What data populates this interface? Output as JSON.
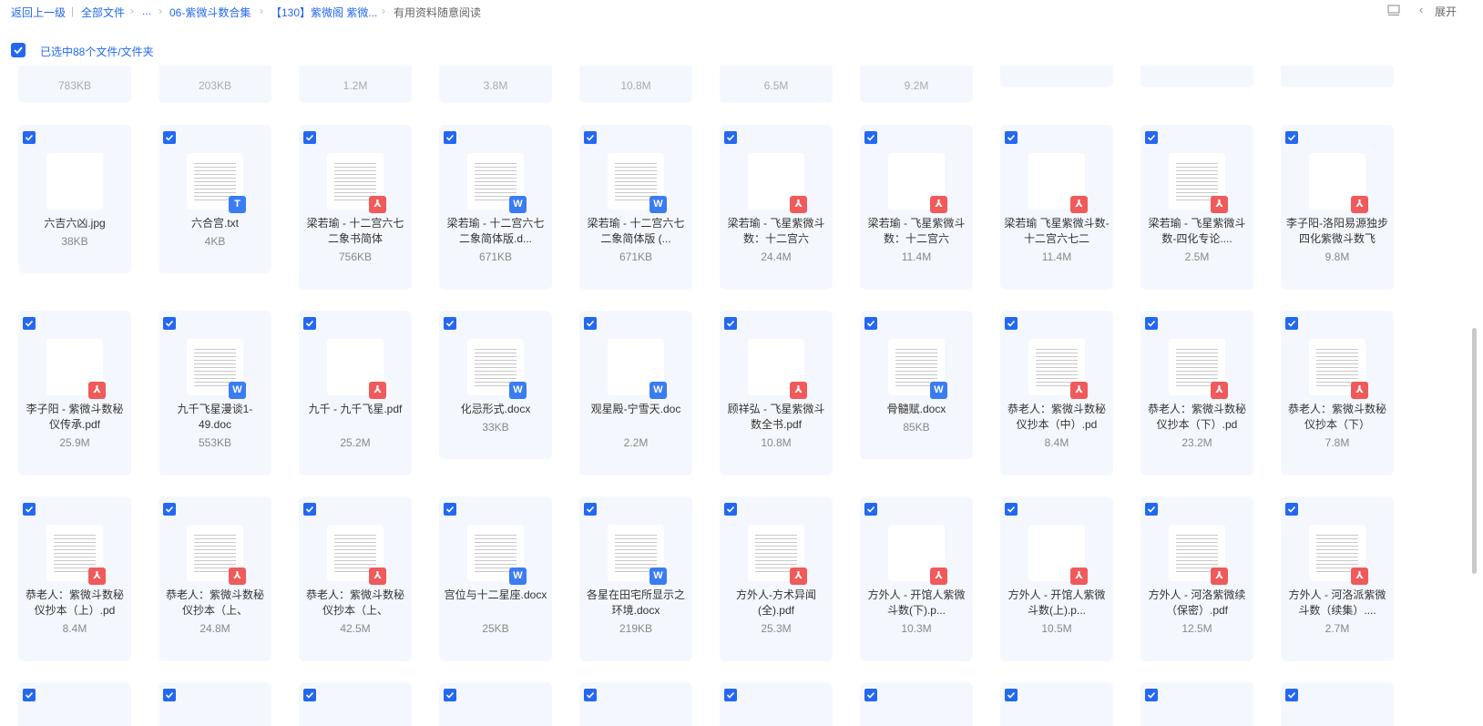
{
  "breadcrumb": {
    "back": "返回上一级",
    "all_files": "全部文件",
    "ellipsis": "...",
    "folder1": "06-紫微斗数合集",
    "folder2": "【130】紫微阁 紫微...",
    "current": "有用资料随意阅读"
  },
  "toolbar": {
    "expand_label": "展开"
  },
  "selection": {
    "text": "已选中88个文件/文件夹"
  },
  "partial_row": [
    "783KB",
    "203KB",
    "1.2M",
    "3.8M",
    "10.8M",
    "6.5M",
    "9.2M",
    "",
    "",
    ""
  ],
  "rows": [
    [
      {
        "name": "六吉六凶.jpg",
        "size": "38KB",
        "type": "jpg",
        "thumb": "dark"
      },
      {
        "name": "六合宫.txt",
        "size": "4KB",
        "type": "txt",
        "thumb": "paper"
      },
      {
        "name": "梁若瑜 - 十二宫六七二象书简体",
        "size": "756KB",
        "type": "pdf",
        "thumb": "paper"
      },
      {
        "name": "梁若瑜 - 十二宫六七二象简体版.d...",
        "size": "671KB",
        "type": "word",
        "thumb": "paper"
      },
      {
        "name": "梁若瑜 - 十二宫六七二象简体版 (...",
        "size": "671KB",
        "type": "word",
        "thumb": "paper"
      },
      {
        "name": "梁若瑜 - 飞星紫微斗数：十二宫六",
        "size": "24.4M",
        "type": "pdf",
        "thumb": "red"
      },
      {
        "name": "梁若瑜 - 飞星紫微斗数：十二宫六",
        "size": "11.4M",
        "type": "pdf",
        "thumb": "red"
      },
      {
        "name": "梁若瑜 飞星紫微斗数-十二宫六七二",
        "size": "11.4M",
        "type": "pdf",
        "thumb": "red"
      },
      {
        "name": "梁若瑜 - 飞星紫微斗数-四化专论....",
        "size": "2.5M",
        "type": "pdf",
        "thumb": "paper"
      },
      {
        "name": "李子阳-洛阳易源独步四化紫微斗数飞",
        "size": "9.8M",
        "type": "pdf",
        "thumb": "grey"
      }
    ],
    [
      {
        "name": "李子阳 - 紫微斗数秘仪传承.pdf",
        "size": "25.9M",
        "type": "pdf",
        "thumb": "red"
      },
      {
        "name": "九千飞星漫谈1-49.doc",
        "size": "553KB",
        "type": "word",
        "thumb": "paper"
      },
      {
        "name": "九千 - 九千飞星.pdf",
        "size": "25.2M",
        "type": "pdf",
        "thumb": "blue"
      },
      {
        "name": "化忌形式.docx",
        "size": "33KB",
        "type": "word",
        "thumb": "paper"
      },
      {
        "name": "观星殿-宁雪天.doc",
        "size": "2.2M",
        "type": "word",
        "thumb": "green"
      },
      {
        "name": "顾祥弘 - 飞星紫微斗数全书.pdf",
        "size": "10.8M",
        "type": "pdf",
        "thumb": "purple"
      },
      {
        "name": "骨髓赋.docx",
        "size": "85KB",
        "type": "word",
        "thumb": "paper"
      },
      {
        "name": "恭老人：紫微斗数秘仪抄本（中）.pd",
        "size": "8.4M",
        "type": "pdf",
        "thumb": "paper"
      },
      {
        "name": "恭老人：紫微斗数秘仪抄本（下）.pd",
        "size": "23.2M",
        "type": "pdf",
        "thumb": "paper"
      },
      {
        "name": "恭老人：紫微斗数秘仪抄本（下）",
        "size": "7.8M",
        "type": "pdf",
        "thumb": "paper"
      }
    ],
    [
      {
        "name": "恭老人：紫微斗数秘仪抄本（上）.pd",
        "size": "8.4M",
        "type": "pdf",
        "thumb": "paper"
      },
      {
        "name": "恭老人：紫微斗数秘仪抄本（上、",
        "size": "24.8M",
        "type": "pdf",
        "thumb": "paper"
      },
      {
        "name": "恭老人：紫微斗数秘仪抄本（上、",
        "size": "42.5M",
        "type": "pdf",
        "thumb": "paper"
      },
      {
        "name": "宫位与十二星座.docx",
        "size": "25KB",
        "type": "word",
        "thumb": "paper"
      },
      {
        "name": "各星在田宅所显示之环境.docx",
        "size": "219KB",
        "type": "word",
        "thumb": "paper"
      },
      {
        "name": "方外人-方术异闻(全).pdf",
        "size": "25.3M",
        "type": "pdf",
        "thumb": "paper"
      },
      {
        "name": "方外人 - 开馆人紫微斗数(下).p...",
        "size": "10.3M",
        "type": "pdf",
        "thumb": "grey"
      },
      {
        "name": "方外人 - 开馆人紫微斗数(上).p...",
        "size": "10.5M",
        "type": "pdf",
        "thumb": "grey"
      },
      {
        "name": "方外人 - 河洛紫微续（保密）.pdf",
        "size": "12.5M",
        "type": "pdf",
        "thumb": "paper"
      },
      {
        "name": "方外人 - 河洛派紫微斗数（续集）....",
        "size": "2.7M",
        "type": "pdf",
        "thumb": "paper"
      }
    ]
  ]
}
